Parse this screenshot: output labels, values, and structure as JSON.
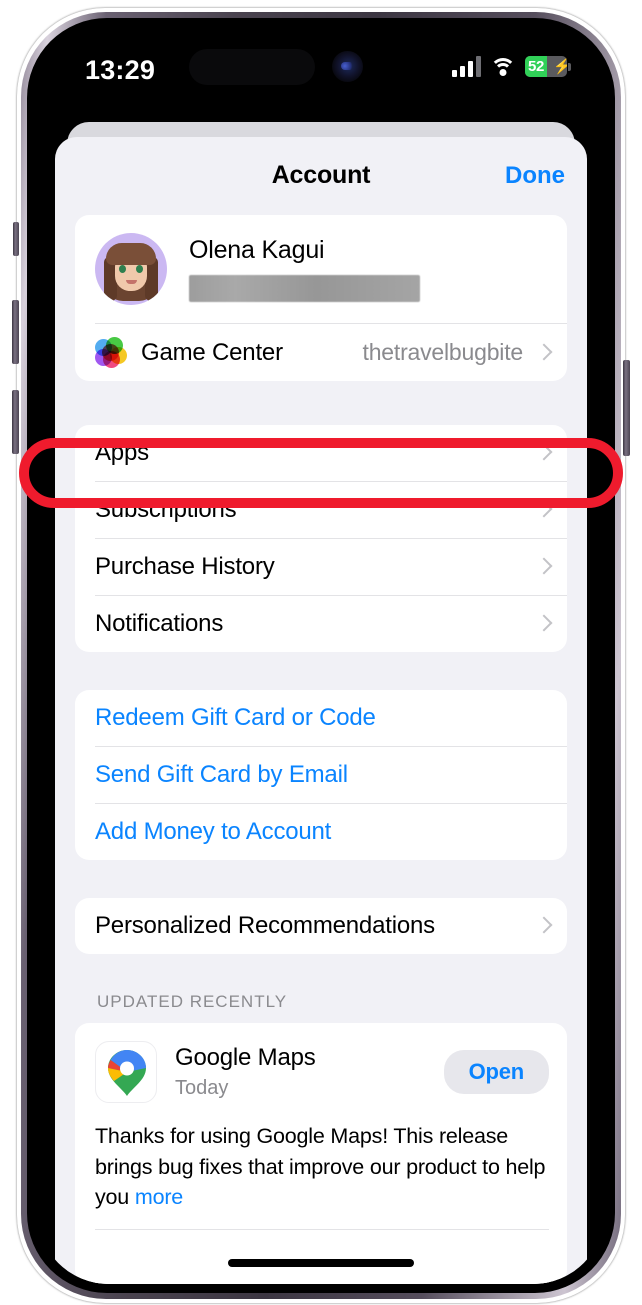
{
  "status_bar": {
    "time": "13:29",
    "cellular_icon": "cellular-signal-icon",
    "wifi_icon": "wifi-icon",
    "battery_percent": "52",
    "battery_charging_icon": "lightning-bolt-icon",
    "battery_level_pct": 52,
    "battery_color": "#31d158"
  },
  "sheet": {
    "title": "Account",
    "done_label": "Done"
  },
  "profile": {
    "avatar_icon": "memoji-avatar",
    "name": "Olena Kagui",
    "email_redacted": true,
    "game_center": {
      "icon": "game-center-icon",
      "label": "Game Center",
      "value": "thetravelbugbite",
      "chevron_icon": "chevron-right-icon"
    }
  },
  "menu_group": {
    "items": [
      {
        "label": "Apps",
        "chevron_icon": "chevron-right-icon",
        "highlighted": true
      },
      {
        "label": "Subscriptions",
        "chevron_icon": "chevron-right-icon",
        "highlighted": false
      },
      {
        "label": "Purchase History",
        "chevron_icon": "chevron-right-icon",
        "highlighted": false
      },
      {
        "label": "Notifications",
        "chevron_icon": "chevron-right-icon",
        "highlighted": false
      }
    ]
  },
  "gift_group": {
    "items": [
      {
        "label": "Redeem Gift Card or Code"
      },
      {
        "label": "Send Gift Card by Email"
      },
      {
        "label": "Add Money to Account"
      }
    ]
  },
  "recommendations_group": {
    "items": [
      {
        "label": "Personalized Recommendations",
        "chevron_icon": "chevron-right-icon"
      }
    ]
  },
  "updated_recently": {
    "section_title": "UPDATED RECENTLY",
    "app": {
      "icon": "google-maps-icon",
      "name": "Google Maps",
      "date": "Today",
      "action_label": "Open",
      "release_notes": "Thanks for using Google Maps! This release brings bug fixes that improve our product to help you",
      "more_label": "more"
    }
  },
  "annotation": {
    "target": "Apps",
    "color": "#ef1b2d",
    "shape": "rounded-rectangle-outline"
  },
  "home_indicator": "home-indicator"
}
